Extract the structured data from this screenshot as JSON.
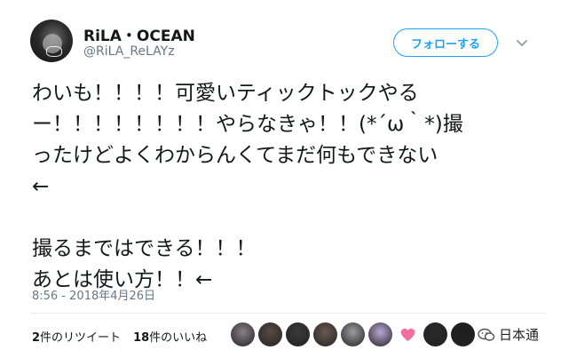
{
  "user": {
    "display_name": "RiLA・OCEAN",
    "handle": "@RiLA_ReLAYz"
  },
  "follow_button": {
    "label": "フォローする"
  },
  "tweet": {
    "lines": [
      "わいも！！！！可愛いティックトックやる",
      "ー！！！！！！！！やらなきゃ！！(*´ω｀*)撮",
      "ったけどよくわからんくてまだ何もできない",
      "←",
      "",
      "撮るまではできる！！！",
      "あとは使い方！！←"
    ],
    "timestamp": "8:56 - 2018年4月26日"
  },
  "stats": {
    "retweet_count": "2",
    "retweet_label": "件のリツイート",
    "like_count": "18",
    "like_label": "件のいいね"
  },
  "likers": [
    {
      "icon": "user-avatar",
      "color": "#8a7f8a"
    },
    {
      "icon": "user-avatar",
      "color": "#5a4a44"
    },
    {
      "icon": "user-avatar",
      "color": "#3a3a3a"
    },
    {
      "icon": "user-avatar",
      "color": "#6b5a50"
    },
    {
      "icon": "user-avatar",
      "color": "#9a9aa0"
    },
    {
      "icon": "user-avatar",
      "color": "#b9a7d6"
    },
    {
      "icon": "heart-avatar",
      "color": "#f06ea0"
    },
    {
      "icon": "user-avatar",
      "color": "#2a2a2a"
    },
    {
      "icon": "user-avatar",
      "color": "#1e1e1e"
    }
  ],
  "watermark": {
    "text": "日本通"
  },
  "colors": {
    "accent": "#1da1f2",
    "muted": "#657786",
    "text": "#14171a"
  }
}
